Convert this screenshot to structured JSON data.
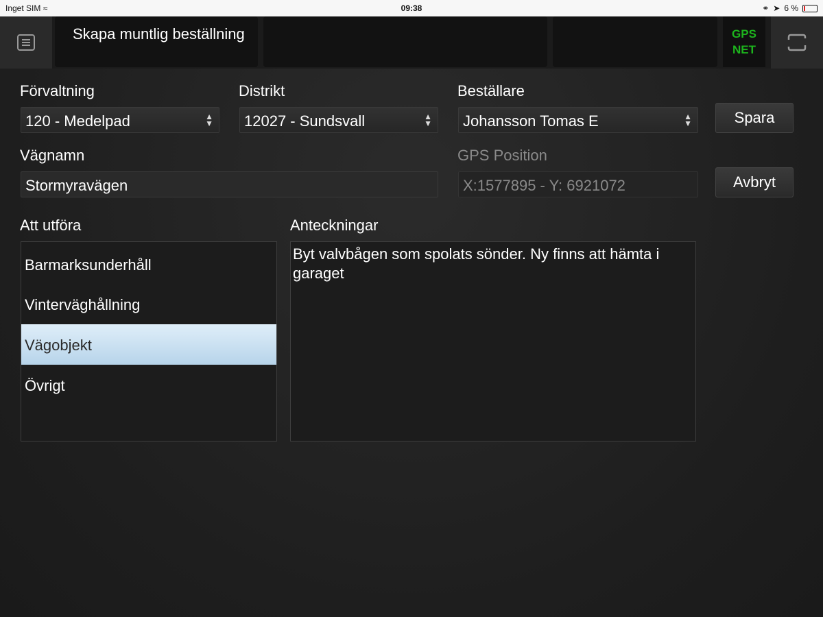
{
  "statusbar": {
    "carrier": "Inget SIM",
    "time": "09:38",
    "battery": "6 %"
  },
  "header": {
    "title": "Skapa muntlig beställning",
    "gps_line1": "GPS",
    "gps_line2": "NET",
    "gps_color": "#1db41d",
    "icons": {
      "menu": "list-icon",
      "rotate": "rotate-screen-icon"
    }
  },
  "form": {
    "forvaltning": {
      "label": "Förvaltning",
      "value": "120 - Medelpad"
    },
    "distrikt": {
      "label": "Distrikt",
      "value": "12027 - Sundsvall"
    },
    "bestallare": {
      "label": "Beställare",
      "value": "Johansson Tomas E"
    },
    "vagnamn": {
      "label": "Vägnamn",
      "value": "Stormyravägen"
    },
    "gps_position": {
      "label": "GPS Position",
      "value": "X:1577895 - Y: 6921072"
    }
  },
  "buttons": {
    "save": "Spara",
    "cancel": "Avbryt"
  },
  "att_utfora": {
    "label": "Att utföra",
    "items": [
      {
        "label": "Barmarksunderhåll",
        "selected": false
      },
      {
        "label": "Vinterväghållning",
        "selected": false
      },
      {
        "label": "Vägobjekt",
        "selected": true
      },
      {
        "label": "Övrigt",
        "selected": false
      }
    ]
  },
  "anteckningar": {
    "label": "Anteckningar",
    "value": "Byt valvbågen som spolats sönder. Ny finns att hämta i garaget"
  }
}
